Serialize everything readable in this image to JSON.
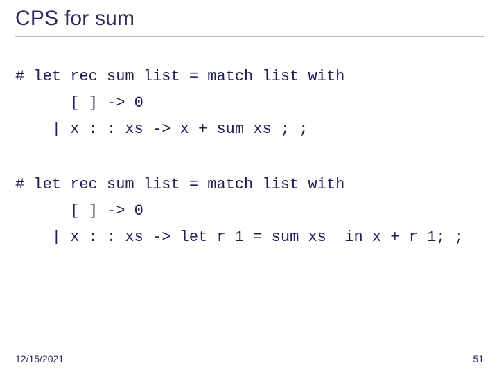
{
  "title": "CPS for sum",
  "code_block1": "# let rec sum list = match list with\n      [ ] -> 0\n    | x : : xs -> x + sum xs ; ;",
  "code_block2": "# let rec sum list = match list with\n      [ ] -> 0\n    | x : : xs -> let r 1 = sum xs  in x + r 1; ;",
  "footer": {
    "date": "12/15/2021",
    "page": "51"
  }
}
